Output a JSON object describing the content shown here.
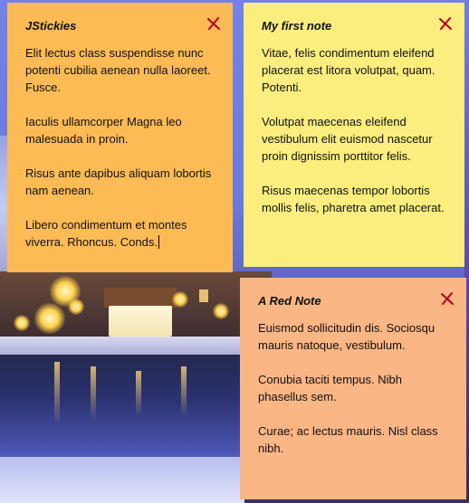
{
  "notes": [
    {
      "title": "JStickies",
      "color": "#fdbb55",
      "paragraphs": [
        "Elit lectus class suspendisse nunc potenti cubilia aenean nulla laoreet. Fusce.",
        "Iaculis ullamcorper Magna leo malesuada in proin.",
        "Risus ante dapibus aliquam lobortis nam aenean.",
        "Libero condimentum et montes viverra. Rhoncus. Conds."
      ],
      "close_icon": "close-x-icon"
    },
    {
      "title": "My first note",
      "color": "#fcee7e",
      "paragraphs": [
        "Vitae, felis condimentum eleifend placerat est litora volutpat, quam. Potenti.",
        "Volutpat maecenas eleifend vestibulum elit euismod nascetur proin dignissim porttitor felis.",
        "Risus maecenas tempor lobortis mollis felis, pharetra amet placerat."
      ],
      "close_icon": "close-x-icon"
    },
    {
      "title": "A Red Note",
      "color": "#fbb685",
      "paragraphs": [
        "Euismod sollicitudin dis. Sociosqu mauris natoque, vestibulum.",
        "Conubia taciti tempus. Nibh phasellus sem.",
        "Curae; ac lectus mauris. Nisl class nibh."
      ],
      "close_icon": "close-x-icon"
    }
  ],
  "colors": {
    "close_icon": "#c8102e",
    "desktop_background": "#6f7fe0"
  }
}
